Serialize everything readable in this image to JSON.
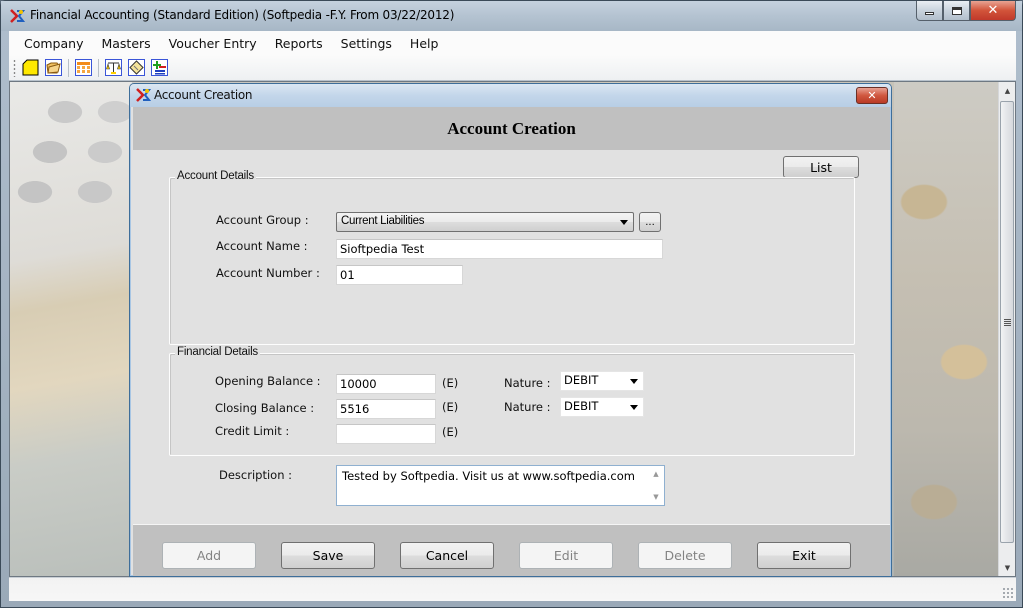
{
  "window": {
    "title": "Financial Accounting (Standard Edition) (Softpedia -F.Y. From 03/22/2012)",
    "icon": "app-logo-icon",
    "controls": {
      "minimize": "minimize-icon",
      "maximize": "maximize-icon",
      "close": "close-icon"
    }
  },
  "menubar": {
    "items": [
      {
        "label": "Company"
      },
      {
        "label": "Masters"
      },
      {
        "label": "Voucher Entry"
      },
      {
        "label": "Reports"
      },
      {
        "label": "Settings"
      },
      {
        "label": "Help"
      }
    ]
  },
  "toolbar": {
    "buttons": [
      {
        "icon": "new-document-icon"
      },
      {
        "icon": "open-folder-icon"
      },
      {
        "icon": "table-grid-icon"
      },
      {
        "icon": "balance-scale-icon"
      },
      {
        "icon": "ledger-note-icon"
      },
      {
        "icon": "add-remove-icon"
      }
    ]
  },
  "dialog": {
    "title": "Account Creation",
    "heading": "Account Creation",
    "list_button": "List",
    "account_details": {
      "legend": "Account Details",
      "account_group_label": "Account Group :",
      "account_group_value": "Current Liabilities",
      "browse_button": "...",
      "account_name_label": "Account Name :",
      "account_name_value": "Sioftpedia Test",
      "account_number_label": "Account Number :",
      "account_number_value": "01"
    },
    "financial_details": {
      "legend": "Financial Details",
      "opening_balance_label": "Opening Balance :",
      "opening_balance_value": "10000",
      "opening_suffix": "(E)",
      "opening_nature_label": "Nature :",
      "opening_nature_value": "DEBIT",
      "closing_balance_label": "Closing Balance :",
      "closing_balance_value": "5516",
      "closing_suffix": "(E)",
      "closing_nature_label": "Nature :",
      "closing_nature_value": "DEBIT",
      "credit_limit_label": "Credit Limit :",
      "credit_limit_value": "",
      "credit_suffix": "(E)"
    },
    "description_label": "Description :",
    "description_value": "Tested by Softpedia. Visit us at www.softpedia.com",
    "buttons": {
      "add": {
        "label": "Add",
        "enabled": false
      },
      "save": {
        "label": "Save",
        "enabled": true
      },
      "cancel": {
        "label": "Cancel",
        "enabled": true
      },
      "edit": {
        "label": "Edit",
        "enabled": false
      },
      "delete": {
        "label": "Delete",
        "enabled": false
      },
      "exit": {
        "label": "Exit",
        "enabled": true
      }
    }
  },
  "scrollbar": {
    "position": 0.0
  }
}
